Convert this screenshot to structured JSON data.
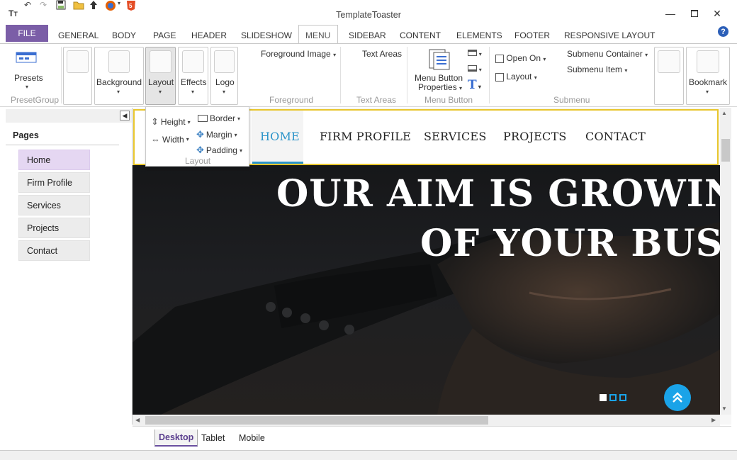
{
  "window": {
    "title": "TemplateToaster"
  },
  "ribbon_tabs": {
    "file": "FILE",
    "items": [
      "GENERAL",
      "BODY",
      "PAGE",
      "HEADER",
      "SLIDESHOW",
      "MENU",
      "SIDEBAR",
      "CONTENT",
      "ELEMENTS",
      "FOOTER",
      "RESPONSIVE LAYOUT"
    ],
    "active": "MENU"
  },
  "ribbon": {
    "presets": "Presets",
    "preset_group": "PresetGroup",
    "background": "Background",
    "layout": "Layout",
    "effects": "Effects",
    "logo": "Logo",
    "foreground_image": "Foreground Image",
    "foreground": "Foreground",
    "text_areas_btn": "Text Areas",
    "text_areas": "Text Areas",
    "menu_button_properties_1": "Menu Button",
    "menu_button_properties_2": "Properties",
    "menu_button": "Menu Button",
    "open_on": "Open On",
    "layout_sub": "Layout",
    "submenu_container": "Submenu Container",
    "submenu_item": "Submenu Item",
    "submenu": "Submenu",
    "bookmark": "Bookmark"
  },
  "layout_dropdown": {
    "height": "Height",
    "width": "Width",
    "border": "Border",
    "margin": "Margin",
    "padding": "Padding",
    "group": "Layout"
  },
  "pages": {
    "title": "Pages",
    "items": [
      "Home",
      "Firm Profile",
      "Services",
      "Projects",
      "Contact"
    ],
    "active": "Home"
  },
  "site_nav": [
    "HOME",
    "FIRM PROFILE",
    "SERVICES",
    "PROJECTS",
    "CONTACT"
  ],
  "hero": {
    "line1": "OUR AIM IS GROWING A",
    "line2": "OF YOUR BUSIN"
  },
  "view_tabs": [
    "Desktop",
    "Tablet",
    "Mobile"
  ],
  "colors": {
    "accent": "#7b5ea7",
    "nav_active": "#2a93c9",
    "menu_outline": "#e8c62c",
    "scroll_top": "#1aa3e8"
  }
}
